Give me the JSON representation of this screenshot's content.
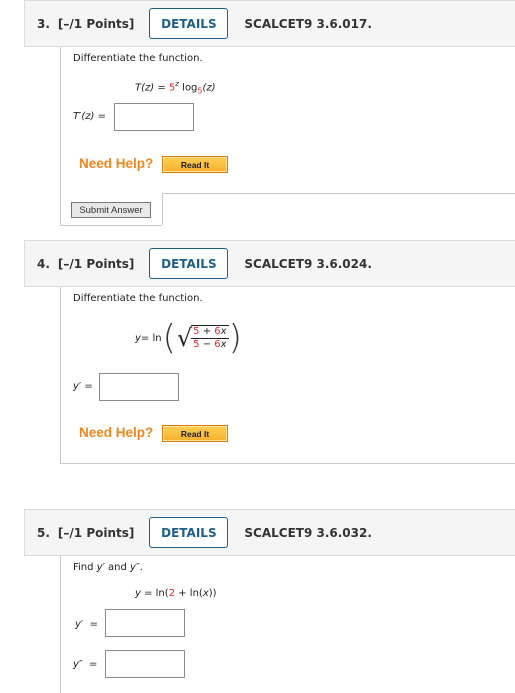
{
  "questions": [
    {
      "number": "3.",
      "points": "[–/1 Points]",
      "details_label": "DETAILS",
      "code": "SCALCET9 3.6.017.",
      "prompt": "Differentiate the function.",
      "function": {
        "lhs": "T(z)",
        "eq": " = ",
        "base": "5",
        "exp": "z",
        "log": " log",
        "log_base": "5",
        "arg": "(z)"
      },
      "answers": [
        {
          "label": "T′(z)",
          "eq": "=",
          "value": ""
        }
      ],
      "need_help": "Need Help?",
      "read_it": "Read It",
      "submit": "Submit Answer"
    },
    {
      "number": "4.",
      "points": "[–/1 Points]",
      "details_label": "DETAILS",
      "code": "SCALCET9 3.6.024.",
      "prompt": "Differentiate the function.",
      "function": {
        "lhs": "y",
        "eq": " = ln",
        "num_a": "5",
        "num_op": " + ",
        "num_b": "6",
        "num_var": "x",
        "den_a": "5",
        "den_op": " − ",
        "den_b": "6",
        "den_var": "x"
      },
      "answers": [
        {
          "label": "y′",
          "eq": "=",
          "value": ""
        }
      ],
      "need_help": "Need Help?",
      "read_it": "Read It"
    },
    {
      "number": "5.",
      "points": "[–/1 Points]",
      "details_label": "DETAILS",
      "code": "SCALCET9 3.6.032.",
      "prompt_pre": "Find ",
      "prompt_y1": "y′",
      "prompt_and": " and ",
      "prompt_y2": "y″",
      "prompt_end": ".",
      "function": {
        "lhs": "y",
        "eq": " = ln(",
        "const": "2",
        "rest": " + ln(",
        "var": "x",
        "close": "))"
      },
      "answers": [
        {
          "label": "y′",
          "eq": "=",
          "value": ""
        },
        {
          "label": "y″",
          "eq": "=",
          "value": ""
        }
      ]
    }
  ],
  "colors": {
    "accent": "#1f5f8b",
    "help": "#f0861e",
    "highlight": "#e8262c"
  }
}
